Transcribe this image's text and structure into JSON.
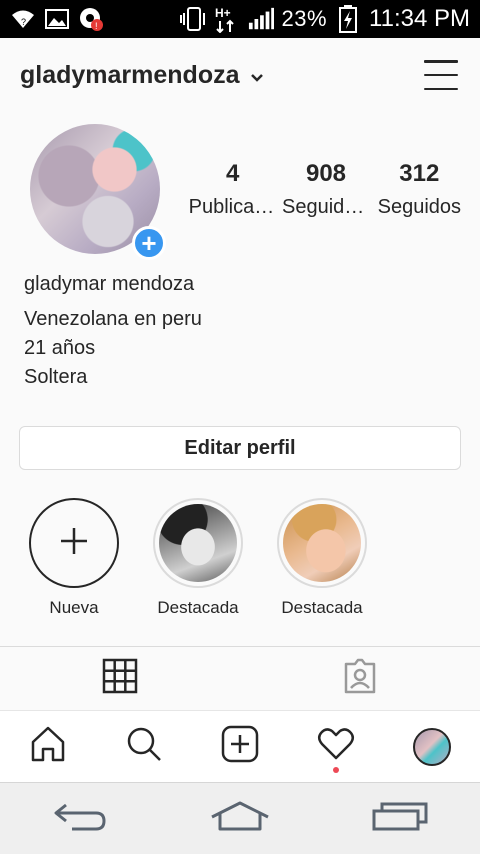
{
  "status_bar": {
    "battery_percent": "23%",
    "time": "11:34 PM",
    "network": "H+",
    "icons": [
      "wifi-icon",
      "image-icon",
      "notification-icon",
      "vibrate-icon",
      "signal-icon",
      "battery-icon"
    ]
  },
  "header": {
    "username": "gladymarmendoza"
  },
  "profile": {
    "stats": [
      {
        "value": "4",
        "label": "Publicaciones"
      },
      {
        "value": "908",
        "label": "Seguidores"
      },
      {
        "value": "312",
        "label": "Seguidos"
      }
    ],
    "name": "gladymar mendoza",
    "bio": [
      "Venezolana en peru",
      "21 años",
      "Soltera"
    ],
    "edit_label": "Editar perfil",
    "add_label": "+"
  },
  "highlights": [
    {
      "label": "Nueva"
    },
    {
      "label": "Destacada"
    },
    {
      "label": "Destacada"
    }
  ],
  "colors": {
    "accent": "#3897f0",
    "notification": "#ed4956",
    "text": "#262626",
    "border": "#dbdbdb"
  }
}
